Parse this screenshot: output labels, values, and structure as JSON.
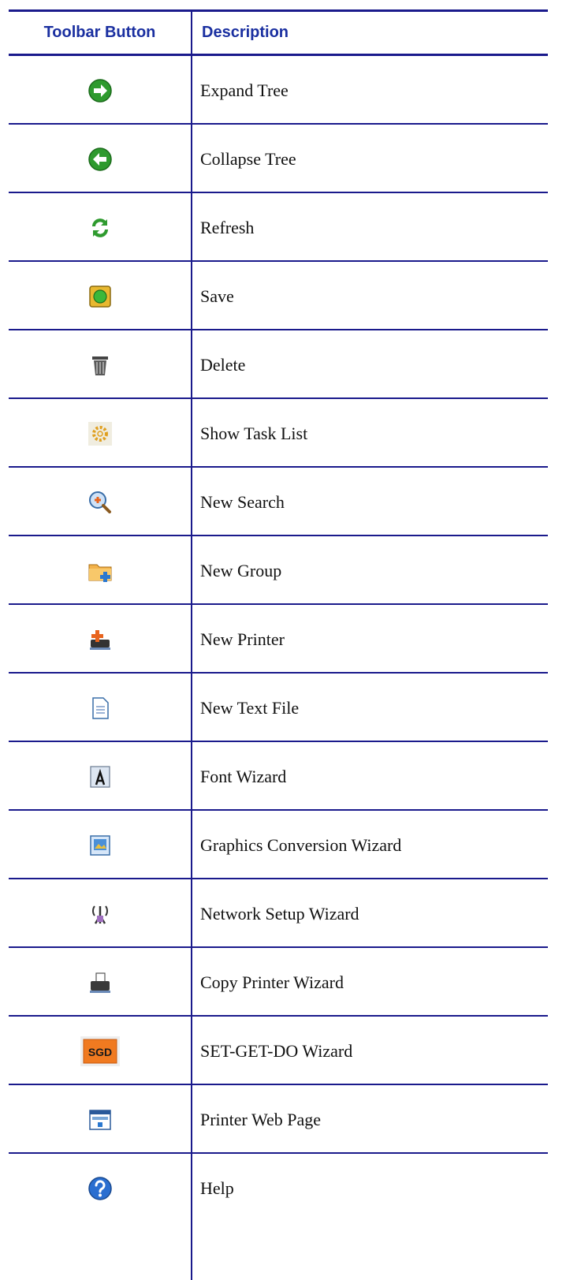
{
  "table": {
    "header": {
      "button_col": "Toolbar Button",
      "desc_col": "Description"
    },
    "rule_color": "#1a1a8c",
    "header_color": "#1a2fa0",
    "rows": [
      {
        "icon": "expand-tree-icon",
        "label": "Expand Tree"
      },
      {
        "icon": "collapse-tree-icon",
        "label": "Collapse Tree"
      },
      {
        "icon": "refresh-icon",
        "label": "Refresh"
      },
      {
        "icon": "save-icon",
        "label": "Save"
      },
      {
        "icon": "delete-icon",
        "label": "Delete"
      },
      {
        "icon": "task-list-icon",
        "label": "Show Task List"
      },
      {
        "icon": "new-search-icon",
        "label": "New Search"
      },
      {
        "icon": "new-group-icon",
        "label": "New Group"
      },
      {
        "icon": "new-printer-icon",
        "label": "New Printer"
      },
      {
        "icon": "new-text-file-icon",
        "label": "New Text File"
      },
      {
        "icon": "font-wizard-icon",
        "label": "Font Wizard"
      },
      {
        "icon": "graphics-conversion-icon",
        "label": "Graphics Conversion Wizard"
      },
      {
        "icon": "network-setup-icon",
        "label": "Network Setup Wizard"
      },
      {
        "icon": "copy-printer-icon",
        "label": "Copy Printer Wizard"
      },
      {
        "icon": "sgd-wizard-icon",
        "label": "SET-GET-DO Wizard",
        "icon_text": "SGD"
      },
      {
        "icon": "printer-web-page-icon",
        "label": "Printer Web Page"
      },
      {
        "icon": "help-icon",
        "label": "Help"
      }
    ]
  }
}
